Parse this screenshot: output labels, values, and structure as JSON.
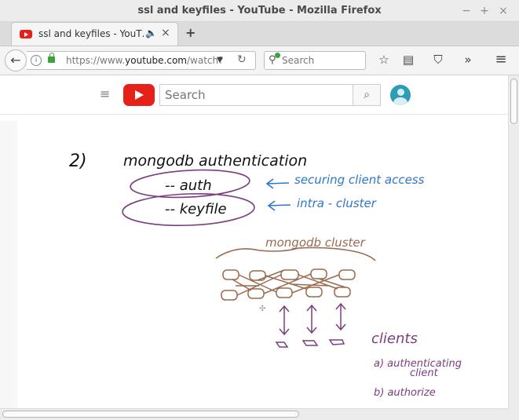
{
  "window": {
    "title": "ssl and keyfiles - YouTube - Mozilla Firefox"
  },
  "window_controls": {
    "minimize": "−",
    "maximize": "+",
    "close": "×"
  },
  "tab": {
    "label": "ssl and keyfiles - YouT…",
    "audio": "🔈",
    "close": "×",
    "new_tab": "+"
  },
  "navbar": {
    "url_prefix": "https://www.",
    "url_domain": "youtube.com",
    "url_path": "/watch?",
    "search_placeholder": "Search",
    "back": "←",
    "drop": "▼",
    "reload": "↻",
    "info": "i"
  },
  "toolbar": {
    "bookmark": "☆",
    "reader": "▤",
    "pocket": "⛉",
    "overflow": "»",
    "menu": "≡"
  },
  "youtube": {
    "menu": "≡",
    "search_placeholder": "Search",
    "search_btn": "⌕"
  },
  "whiteboard": {
    "item_number": "2)",
    "heading": "mongodb authentication",
    "auth": "-- auth",
    "keyfile": "-- keyfile",
    "note_auth": "securing client access",
    "note_keyfile": "intra - cluster",
    "cluster_label": "mongodb cluster",
    "clients": "clients",
    "client_a1": "a) authenticating",
    "client_a2": "client",
    "client_b": "b) authorize"
  },
  "colors": {
    "ink": "#111111",
    "purple": "#7b3d7e",
    "blue": "#2f76c9",
    "brown": "#9a6a4e"
  }
}
